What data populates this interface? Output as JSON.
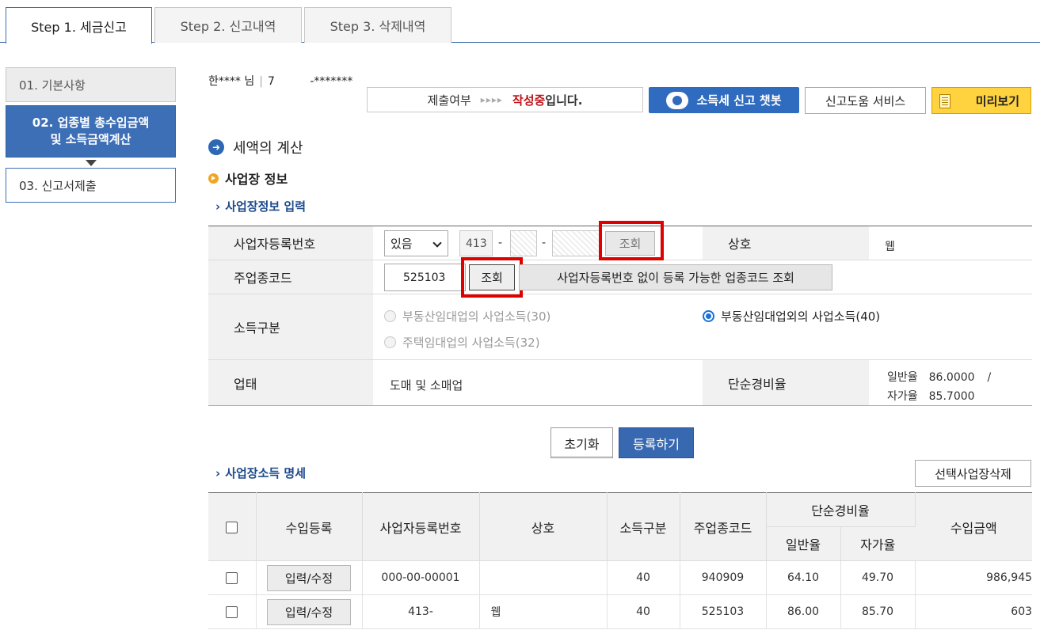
{
  "tabs": [
    {
      "label": "Step 1. 세금신고",
      "active": true
    },
    {
      "label": "Step 2. 신고내역",
      "active": false
    },
    {
      "label": "Step 3. 삭제내역",
      "active": false
    }
  ],
  "sidebar": {
    "steps": [
      {
        "label": "01. 기본사항"
      },
      {
        "label": "02. 업종별 총수입금액\n및 소득금액계산"
      },
      {
        "label": "03. 신고서제출"
      }
    ]
  },
  "user": {
    "name": "한**** 님",
    "id_prefix": "7",
    "id_masked": "-*******"
  },
  "status": {
    "label": "제출여부",
    "arrows": "▸▸▸▸",
    "state": "작성중",
    "suffix": "입니다."
  },
  "header_buttons": {
    "chatbot": "소득세 신고 챗봇",
    "help": "신고도움 서비스",
    "preview": "미리보기"
  },
  "section_title": "세액의 계산",
  "sub_title": "사업장 정보",
  "form_title": "사업장정보 입력",
  "form": {
    "biz_no_label": "사업자등록번호",
    "biz_no_select": "있음",
    "biz_no_part1": "413",
    "biz_no_part2": "",
    "biz_no_part3": "",
    "biz_no_lookup": "조회",
    "shop_label": "상호",
    "shop_value": "웹",
    "main_code_label": "주업종코드",
    "main_code_value": "525103",
    "main_code_lookup": "조회",
    "no_biz_code_lookup": "사업자등록번호 없이 등록 가능한 업종코드 조회",
    "income_type_label": "소득구분",
    "income_options": [
      {
        "label": "부동산임대업의 사업소득(30)",
        "selected": false,
        "disabled": true
      },
      {
        "label": "주택임대업의 사업소득(32)",
        "selected": false,
        "disabled": true
      },
      {
        "label": "부동산임대업외의 사업소득(40)",
        "selected": true,
        "disabled": false
      }
    ],
    "business_type_label": "업태",
    "business_type_value": "도매 및 소매업",
    "simple_rate_label": "단순경비율",
    "general_rate_label": "일반율",
    "general_rate_value": "86.0000",
    "rate_slash": "/",
    "self_rate_label": "자가율",
    "self_rate_value": "85.7000"
  },
  "actions": {
    "reset": "초기화",
    "register": "등록하기"
  },
  "list_title": "사업장소득 명세",
  "list_delete": "선택사업장삭제",
  "table": {
    "headers": {
      "income_reg": "수입등록",
      "biz_no": "사업자등록번호",
      "shop": "상호",
      "income_type": "소득구분",
      "main_code": "주업종코드",
      "simple_rate": "단순경비율",
      "general": "일반율",
      "self": "자가율",
      "income_amount": "수입금액"
    },
    "edit_label": "입력/수정",
    "rows": [
      {
        "biz_no": "000-00-00001",
        "shop": "",
        "income_type": "40",
        "main_code": "940909",
        "general": "64.10",
        "self": "49.70",
        "amount": "986,945"
      },
      {
        "biz_no": "413-",
        "shop": "웹",
        "income_type": "40",
        "main_code": "525103",
        "general": "86.00",
        "self": "85.70",
        "amount": "603"
      }
    ]
  },
  "colors": {
    "primary": "#3d6fb6",
    "accent_red": "#c0151a",
    "highlight": "#e00000",
    "preview_yellow": "#ffd23f"
  }
}
